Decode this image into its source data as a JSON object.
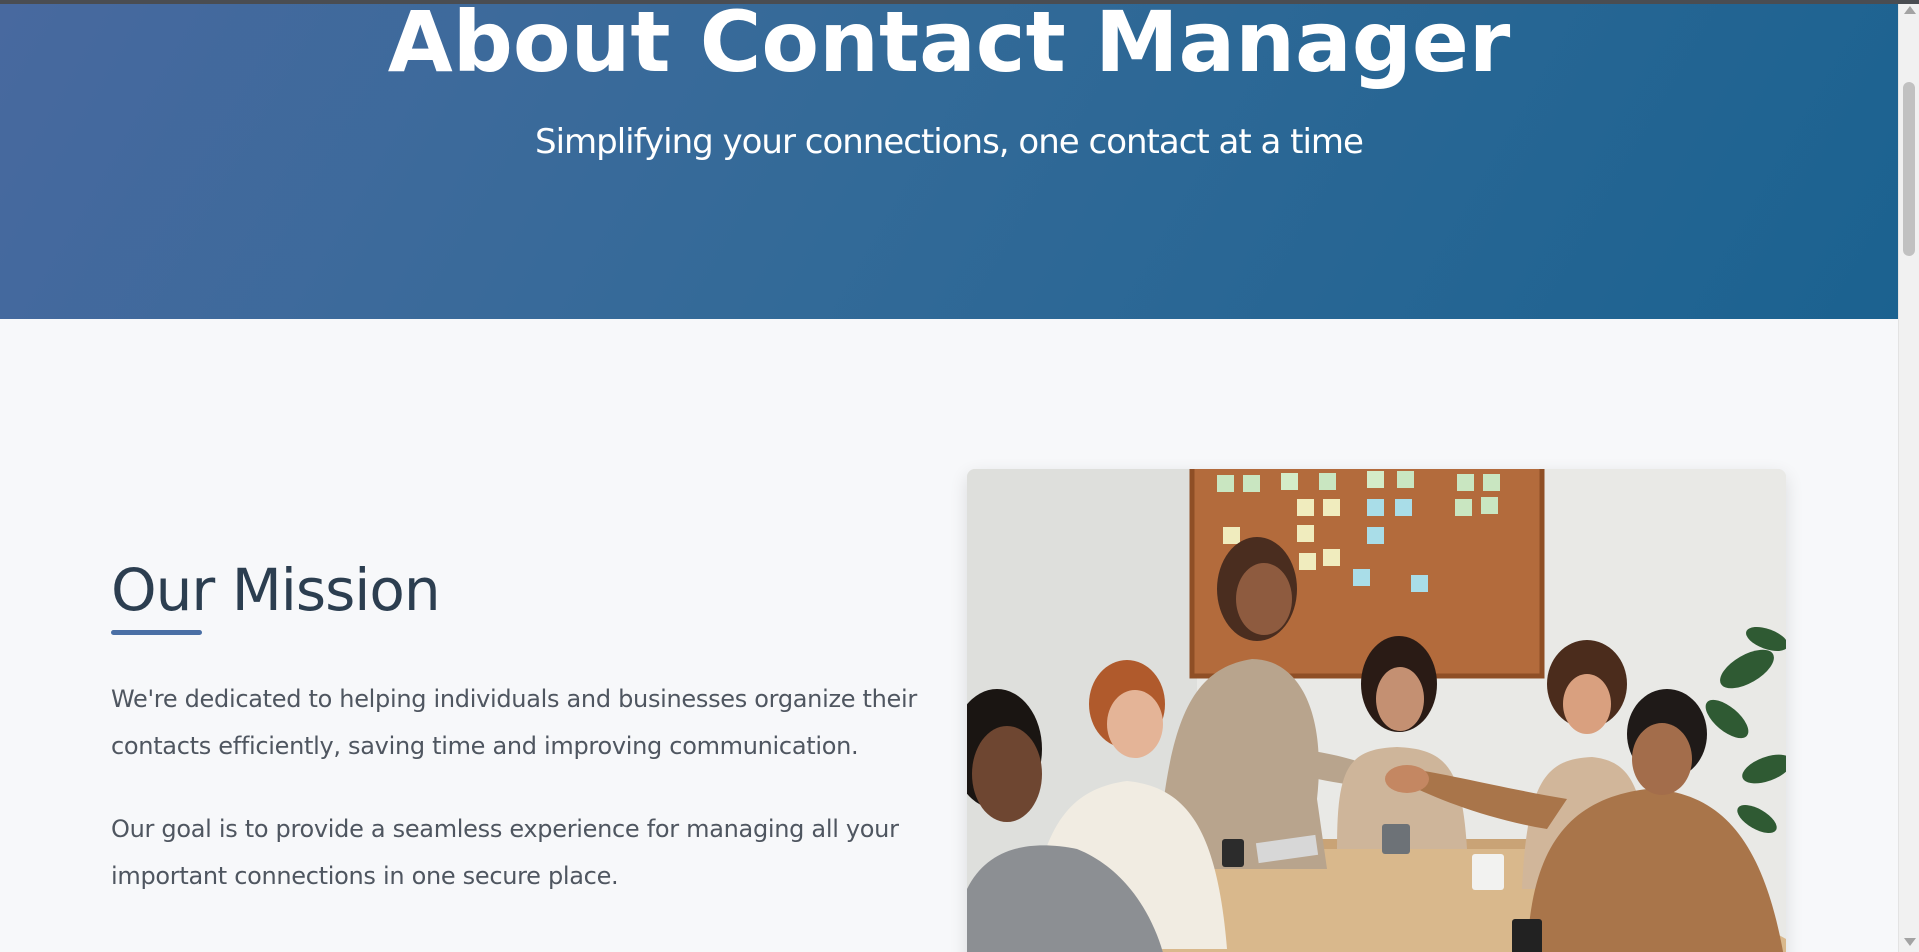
{
  "hero": {
    "title": "About Contact Manager",
    "subtitle": "Simplifying your connections, one contact at a time",
    "gradient_start": "#48699f",
    "gradient_end": "#1b6290"
  },
  "mission": {
    "title": "Our Mission",
    "paragraph_1": "We're dedicated to helping individuals and businesses organize their contacts efficiently, saving time and improving communication.",
    "paragraph_2": "Our goal is to provide a seamless experience for managing all your important connections in one secure place.",
    "accent_color": "#4a6fa5"
  },
  "photo": {
    "icon": "team-meeting-photo"
  },
  "scrollbar": {
    "up_icon": "chevron-up-icon",
    "down_icon": "chevron-down-icon"
  }
}
